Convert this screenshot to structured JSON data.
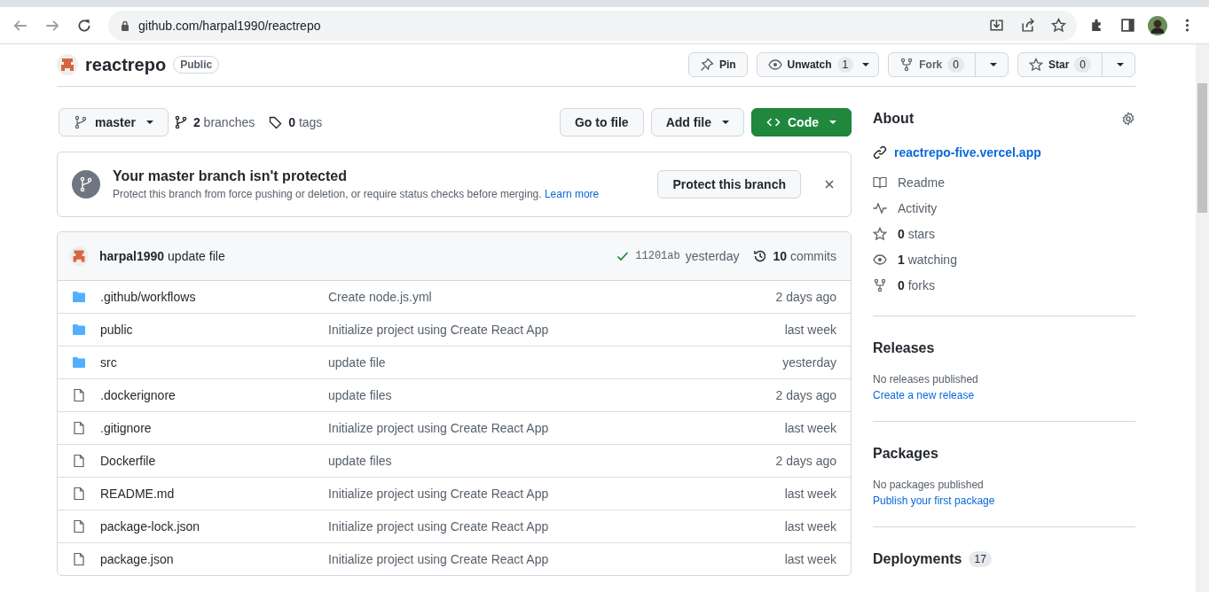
{
  "browser": {
    "url": "github.com/harpal1990/reactrepo"
  },
  "repo": {
    "name": "reactrepo",
    "visibility": "Public"
  },
  "actions": [
    {
      "kind": "pin",
      "label": "Pin"
    },
    {
      "kind": "watch",
      "label": "Unwatch",
      "count": "1"
    },
    {
      "kind": "fork",
      "label": "Fork",
      "count": "0"
    },
    {
      "kind": "star",
      "label": "Star",
      "count": "0"
    }
  ],
  "branch_bar": {
    "branch": "master",
    "branches": "**2** branches",
    "tags": "**0** tags",
    "buttons": [
      "Go to file",
      "Add file"
    ],
    "code_button": "Code"
  },
  "banner": {
    "title": "Your master branch isn't protected",
    "text": "Protect this branch from force pushing or deletion, or require status checks before merging.",
    "link": "Learn more",
    "button": "Protect this branch"
  },
  "commit": {
    "summary": "**harpal1990** update file",
    "sha": "11201ab",
    "time": "yesterday",
    "commits": "**10** commits"
  },
  "files": [
    {
      "kind": "folder",
      "name": ".github/workflows",
      "message": "Create node.js.yml",
      "age": "2 days ago"
    },
    {
      "kind": "folder",
      "name": "public",
      "message": "Initialize project using Create React App",
      "age": "last week"
    },
    {
      "kind": "folder",
      "name": "src",
      "message": "update file",
      "age": "yesterday"
    },
    {
      "kind": "file",
      "name": ".dockerignore",
      "message": "update files",
      "age": "2 days ago"
    },
    {
      "kind": "file",
      "name": ".gitignore",
      "message": "Initialize project using Create React App",
      "age": "last week"
    },
    {
      "kind": "file",
      "name": "Dockerfile",
      "message": "update files",
      "age": "2 days ago"
    },
    {
      "kind": "file",
      "name": "README.md",
      "message": "Initialize project using Create React App",
      "age": "last week"
    },
    {
      "kind": "file",
      "name": "package-lock.json",
      "message": "Initialize project using Create React App",
      "age": "last week"
    },
    {
      "kind": "file",
      "name": "package.json",
      "message": "Initialize project using Create React App",
      "age": "last week"
    }
  ],
  "about": {
    "title": "About",
    "website": "reactrepo-five.vercel.app",
    "items": [
      {
        "kind": "book",
        "text": "Readme"
      },
      {
        "kind": "activity",
        "text": "Activity"
      },
      {
        "kind": "star",
        "text": "**0** stars"
      },
      {
        "kind": "eye",
        "text": "**1** watching"
      },
      {
        "kind": "fork",
        "text": "**0** forks"
      }
    ]
  },
  "sections": [
    {
      "title": "Releases",
      "text": "No releases published",
      "link": "Create a new release"
    },
    {
      "title": "Packages",
      "text": "No packages published",
      "link": "Publish your first package"
    },
    {
      "title": "Deployments",
      "count": "17"
    }
  ]
}
